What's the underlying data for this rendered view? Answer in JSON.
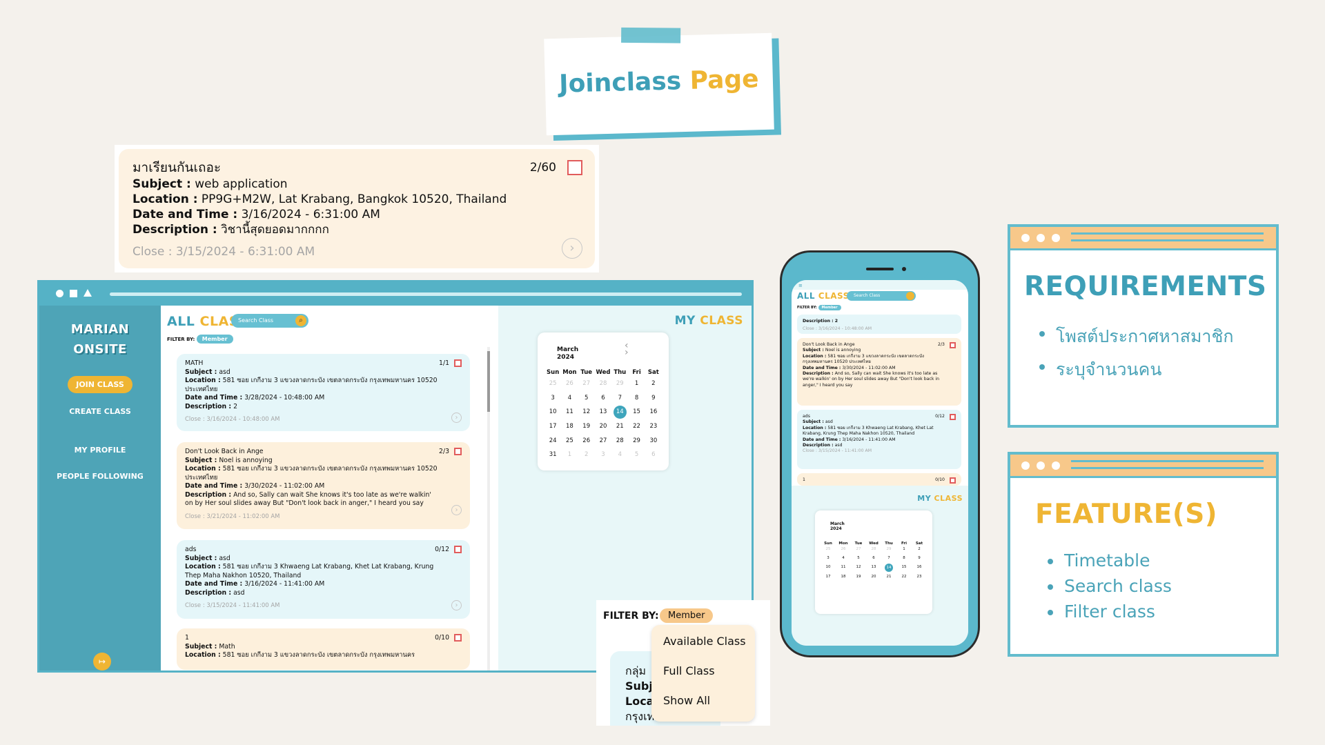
{
  "title": {
    "part1": "Joinclass",
    "part2": "Page"
  },
  "big_card": {
    "name": "มาเรียนกันเถอะ",
    "count": "2/60",
    "subject_label": "Subject :",
    "subject": "web application",
    "location_label": "Location :",
    "location": "PP9G+M2W, Lat Krabang, Bangkok 10520, Thailand",
    "datetime_label": "Date and Time :",
    "datetime": "3/16/2024 - 6:31:00 AM",
    "desc_label": "Description :",
    "desc": "วิชานี้สุดยอดมากกกก",
    "close": "Close : 3/15/2024 - 6:31:00 AM"
  },
  "sidebar": {
    "logo1": "MARIAN",
    "logo2": "ONSITE",
    "join": "JOIN CLASS",
    "create": "CREATE CLASS",
    "profile": "MY PROFILE",
    "following": "PEOPLE FOLLOWING"
  },
  "all_class": {
    "h1": "ALL",
    "h2": "CLASS",
    "search_placeholder": "Search Class",
    "filter_label": "FILTER BY:",
    "filter_value": "Member"
  },
  "my_class": {
    "h1": "MY",
    "h2": "CLASS"
  },
  "labels": {
    "subject": "Subject :",
    "location": "Location :",
    "datetime": "Date and Time :",
    "desc": "Description :"
  },
  "classes": [
    {
      "name": "MATH",
      "count": "1/1",
      "subject": "asd",
      "location": "581 ซอย เกกีงาม 3 แขวงลาดกระบัง เขตลาดกระบัง กรุงเทพมหานคร 10520 ประเทศไทย",
      "datetime": "3/28/2024 - 10:48:00 AM",
      "desc": "2",
      "close": "Close : 3/16/2024 - 10:48:00 AM"
    },
    {
      "name": "Don't Look Back in Ange",
      "count": "2/3",
      "subject": "Noel is annoying",
      "location": "581 ซอย เกกีงาม 3 แขวงลาดกระบัง เขตลาดกระบัง กรุงเทพมหานคร 10520 ประเทศไทย",
      "datetime": "3/30/2024 - 11:02:00 AM",
      "desc": "And so, Sally can wait She knows it's too late as we're walkin' on by Her soul slides away But \"Don't look back in anger,\" I heard you say",
      "close": "Close : 3/21/2024 - 11:02:00 AM"
    },
    {
      "name": "ads",
      "count": "0/12",
      "subject": "asd",
      "location": "581 ซอย เกกีงาม 3 Khwaeng Lat Krabang, Khet Lat Krabang, Krung Thep Maha Nakhon 10520, Thailand",
      "datetime": "3/16/2024 - 11:41:00 AM",
      "desc": "asd",
      "close": "Close : 3/15/2024 - 11:41:00 AM"
    },
    {
      "name": "1",
      "count": "0/10",
      "subject": "Math",
      "location": "581 ซอย เกกีงาม 3 แขวงลาดกระบัง เขตลาดกระบัง กรุงเทพมหานคร"
    }
  ],
  "calendar": {
    "month": "March",
    "year": "2024",
    "days": [
      "Sun",
      "Mon",
      "Tue",
      "Wed",
      "Thu",
      "Fri",
      "Sat"
    ],
    "cells": [
      "25",
      "26",
      "27",
      "28",
      "29",
      "1",
      "2",
      "3",
      "4",
      "5",
      "6",
      "7",
      "8",
      "9",
      "10",
      "11",
      "12",
      "13",
      "14",
      "15",
      "16",
      "17",
      "18",
      "19",
      "20",
      "21",
      "22",
      "23",
      "24",
      "25",
      "26",
      "27",
      "28",
      "29",
      "30",
      "31",
      "1",
      "2",
      "3",
      "4",
      "5",
      "6"
    ],
    "first_in_month": 5,
    "last_in_month": 35,
    "selected": "14"
  },
  "filter_popup": {
    "label": "FILTER BY:",
    "value": "Member",
    "options": [
      "Available Class",
      "Full Class",
      "Show All"
    ],
    "peek": [
      "กลุ่ม",
      "Subj",
      "Loca",
      "กรุงเท"
    ]
  },
  "phone": {
    "first_desc": "Description : 2",
    "first_close": "Close : 3/16/2024 - 10:48:00 AM",
    "card2_location": "581 ซอย เกกีงาม 3 แขวงลาดกระบัง เขตลาดกระบัง กรุงเทพมหานคร 10520 ประเทศไทย",
    "card3_location": "581 ซอย เกกีงาม 3 Khwaeng Lat Krabang, Khet Lat Krabang, Krung Thep Maha Nakhon 10520, Thailand",
    "card4_name": "1",
    "card4_count": "0/10"
  },
  "requirements": {
    "title": "REQUIREMENTS",
    "items": [
      "โพสต์ประกาศหาสมาชิก",
      "ระบุจำนวนคน"
    ]
  },
  "features": {
    "title": "FEATURE(S)",
    "items": [
      "Timetable",
      "Search class",
      "Filter class"
    ]
  },
  "colors": {
    "teal": "#55b2c6",
    "yellow": "#efb533",
    "peach": "#fdf0dc",
    "light_blue": "#e5f6f9",
    "red": "#e15b5b"
  }
}
